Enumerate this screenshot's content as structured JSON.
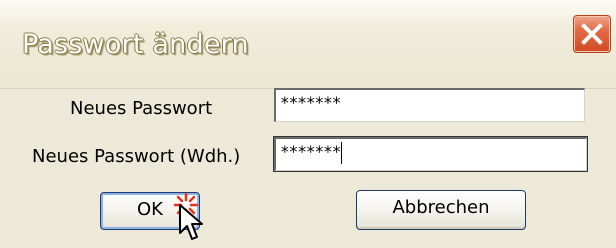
{
  "window": {
    "title": "Passwort ändern",
    "close_icon": "close-icon"
  },
  "form": {
    "new_password_label": "Neues Passwort",
    "new_password_value": "*******",
    "repeat_password_label": "Neues Passwort (Wdh.)",
    "repeat_password_value": "*******"
  },
  "buttons": {
    "ok_label": "OK",
    "cancel_label": "Abbrechen"
  },
  "colors": {
    "title_bar": "#ebe7d1",
    "close_button": "#d14a24",
    "dialog_background": "#ece9d8",
    "button_focus_border": "#8fb2e6",
    "click_flash": "#e8341c"
  },
  "icons": [
    "close-icon",
    "mouse-pointer-icon",
    "click-flash-icon"
  ]
}
